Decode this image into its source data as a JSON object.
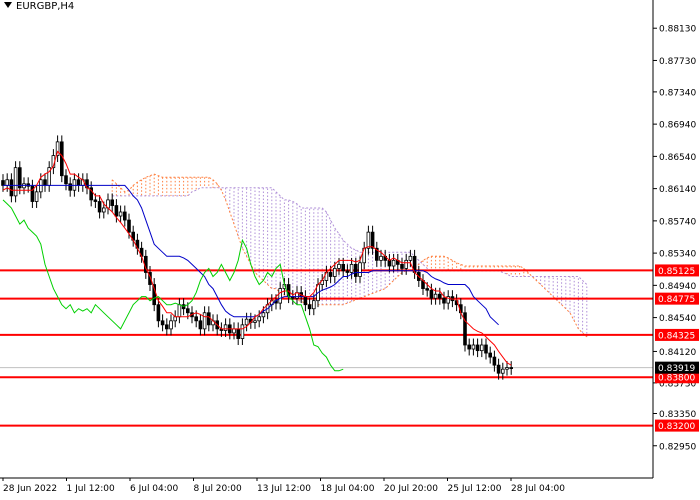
{
  "symbol": "EURGBP,H4",
  "colors": {
    "background": "#ffffff",
    "axis": "#000000",
    "candle": "#000000",
    "tenkan": "#ff0000",
    "kijun": "#0000c8",
    "chikou": "#00d000",
    "cloud_a": "#ff8040",
    "cloud_b": "#b090d8",
    "level_line": "#ff0000",
    "level_label_bg": "#ff0000",
    "level_label_text": "#ffffff",
    "current_price_bg": "#000000",
    "current_price_text": "#ffffff"
  },
  "chart_data": {
    "type": "candlestick",
    "title": "EURGBP,H4",
    "ylim": [
      0.8255,
      0.8848
    ],
    "y_ticks": [
      "0.88130",
      "0.87730",
      "0.87340",
      "0.86940",
      "0.86540",
      "0.86140",
      "0.85740",
      "0.85340",
      "0.84940",
      "0.84540",
      "0.84120",
      "0.83730",
      "0.83350",
      "0.82950"
    ],
    "x_tick_labels": [
      "28 Jun 2022",
      "1 Jul 12:00",
      "6 Jul 04:00",
      "8 Jul 20:00",
      "13 Jul 12:00",
      "18 Jul 04:00",
      "20 Jul 20:00",
      "25 Jul 12:00",
      "28 Jul 04:00"
    ],
    "levels": [
      {
        "label": "0.85125",
        "value": 0.85125
      },
      {
        "label": "0.84775",
        "value": 0.84775
      },
      {
        "label": "0.84325",
        "value": 0.84325
      },
      {
        "label": "0.83800",
        "value": 0.838
      },
      {
        "label": "0.83200",
        "value": 0.832
      }
    ],
    "current_price": {
      "label": "0.83919",
      "value": 0.83919
    },
    "close": [
      0.8618,
      0.8625,
      0.8605,
      0.864,
      0.8615,
      0.862,
      0.8617,
      0.8598,
      0.861,
      0.8625,
      0.8618,
      0.864,
      0.8655,
      0.8672,
      0.863,
      0.862,
      0.8612,
      0.8625,
      0.8618,
      0.8625,
      0.8615,
      0.86,
      0.8598,
      0.8585,
      0.859,
      0.86,
      0.8593,
      0.858,
      0.8585,
      0.8575,
      0.856,
      0.855,
      0.854,
      0.853,
      0.851,
      0.8495,
      0.847,
      0.845,
      0.8445,
      0.844,
      0.845,
      0.8455,
      0.847,
      0.8465,
      0.846,
      0.8455,
      0.845,
      0.844,
      0.846,
      0.8445,
      0.845,
      0.844,
      0.8438,
      0.8445,
      0.8435,
      0.844,
      0.8428,
      0.8445,
      0.8452,
      0.8448,
      0.845,
      0.8455,
      0.846,
      0.847,
      0.8475,
      0.8472,
      0.849,
      0.8495,
      0.848,
      0.8478,
      0.8485,
      0.848,
      0.847,
      0.8465,
      0.8475,
      0.8495,
      0.85,
      0.851,
      0.8505,
      0.8515,
      0.852,
      0.8512,
      0.851,
      0.852,
      0.8505,
      0.8522,
      0.854,
      0.856,
      0.854,
      0.8525,
      0.853,
      0.8525,
      0.8518,
      0.8525,
      0.852,
      0.8515,
      0.8525,
      0.853,
      0.851,
      0.85,
      0.849,
      0.8488,
      0.8478,
      0.8483,
      0.8478,
      0.8472,
      0.848,
      0.8475,
      0.847,
      0.846,
      0.842,
      0.8415,
      0.842,
      0.8413,
      0.842,
      0.841,
      0.8405,
      0.8395,
      0.8385,
      0.839,
      0.8392,
      0.8391
    ],
    "tenkan": [
      0.8612,
      0.8615,
      0.8612,
      0.8612,
      0.8612,
      0.8612,
      0.8612,
      0.8612,
      0.8618,
      0.8628,
      0.8632,
      0.8635,
      0.8642,
      0.866,
      0.8655,
      0.8645,
      0.8632,
      0.8632,
      0.8628,
      0.8625,
      0.8615,
      0.8612,
      0.8605,
      0.8605,
      0.8595,
      0.859,
      0.8585,
      0.8578,
      0.8572,
      0.8565,
      0.8558,
      0.855,
      0.854,
      0.853,
      0.8515,
      0.8505,
      0.849,
      0.8475,
      0.8468,
      0.846,
      0.846,
      0.8455,
      0.8455,
      0.8455,
      0.8455,
      0.8458,
      0.846,
      0.8458,
      0.8455,
      0.8455,
      0.845,
      0.8445,
      0.844,
      0.844,
      0.844,
      0.844,
      0.844,
      0.844,
      0.8443,
      0.8448,
      0.8455,
      0.8458,
      0.8465,
      0.847,
      0.8475,
      0.848,
      0.8485,
      0.8487,
      0.8487,
      0.8482,
      0.8485,
      0.8482,
      0.848,
      0.848,
      0.8485,
      0.8495,
      0.85,
      0.851,
      0.8515,
      0.852,
      0.8525,
      0.8525,
      0.8525,
      0.8525,
      0.8523,
      0.8525,
      0.854,
      0.8542,
      0.8542,
      0.8538,
      0.8535,
      0.853,
      0.8525,
      0.8528,
      0.8525,
      0.8522,
      0.8522,
      0.8522,
      0.851,
      0.8505,
      0.85,
      0.8495,
      0.849,
      0.8487,
      0.8487,
      0.848,
      0.8478,
      0.8477,
      0.8477,
      0.846,
      0.845,
      0.8445,
      0.844,
      0.8437,
      0.8435,
      0.843,
      0.8425,
      0.842,
      0.8412,
      0.8405,
      0.8398,
      0.8395
    ],
    "kijun": [
      0.8618,
      0.8618,
      0.8618,
      0.8618,
      0.8618,
      0.8618,
      0.8618,
      0.8618,
      0.8618,
      0.8618,
      0.8618,
      0.8618,
      0.8618,
      0.8618,
      0.8618,
      0.8618,
      0.8618,
      0.8618,
      0.8618,
      0.8618,
      0.8618,
      0.8618,
      0.8618,
      0.8618,
      0.8618,
      0.8618,
      0.8618,
      0.8618,
      0.8618,
      0.8618,
      0.8612,
      0.8605,
      0.86,
      0.859,
      0.8575,
      0.856,
      0.8545,
      0.854,
      0.8535,
      0.853,
      0.853,
      0.853,
      0.853,
      0.8528,
      0.8525,
      0.852,
      0.8515,
      0.851,
      0.8505,
      0.8495,
      0.849,
      0.848,
      0.847,
      0.8462,
      0.8458,
      0.8455,
      0.8455,
      0.8455,
      0.8455,
      0.8455,
      0.8455,
      0.8458,
      0.8462,
      0.8465,
      0.847,
      0.8475,
      0.8478,
      0.848,
      0.848,
      0.848,
      0.848,
      0.848,
      0.848,
      0.848,
      0.848,
      0.8485,
      0.8488,
      0.849,
      0.8492,
      0.8495,
      0.85,
      0.8505,
      0.8505,
      0.8508,
      0.851,
      0.851,
      0.851,
      0.851,
      0.8512,
      0.8512,
      0.8512,
      0.8512,
      0.8512,
      0.8512,
      0.8512,
      0.8512,
      0.8512,
      0.8512,
      0.8512,
      0.8512,
      0.8512,
      0.851,
      0.8505,
      0.8502,
      0.85,
      0.8497,
      0.8495,
      0.8495,
      0.8495,
      0.8495,
      0.8495,
      0.849,
      0.848,
      0.8475,
      0.847,
      0.8465,
      0.8455,
      0.845,
      0.8445
    ],
    "chikou": [
      0.86,
      0.8595,
      0.859,
      0.858,
      0.857,
      0.8575,
      0.8565,
      0.856,
      0.8555,
      0.8545,
      0.852,
      0.8505,
      0.849,
      0.848,
      0.847,
      0.8465,
      0.847,
      0.846,
      0.8465,
      0.8462,
      0.8465,
      0.846,
      0.847,
      0.8465,
      0.846,
      0.8455,
      0.845,
      0.8445,
      0.844,
      0.845,
      0.846,
      0.847,
      0.8475,
      0.848,
      0.848,
      0.8475,
      0.8478,
      0.848,
      0.8475,
      0.847,
      0.847,
      0.8472,
      0.847,
      0.8468,
      0.847,
      0.8475,
      0.8485,
      0.85,
      0.851,
      0.8515,
      0.8505,
      0.851,
      0.852,
      0.851,
      0.85,
      0.851,
      0.8525,
      0.855,
      0.854,
      0.852,
      0.8505,
      0.8495,
      0.85,
      0.851,
      0.8505,
      0.8515,
      0.852,
      0.8495,
      0.848,
      0.8475,
      0.847,
      0.847,
      0.8455,
      0.844,
      0.842,
      0.8418,
      0.841,
      0.8405,
      0.8395,
      0.8388,
      0.8388,
      0.839
    ],
    "span_a": [
      0.8625,
      0.862,
      0.8615,
      0.861,
      0.8612,
      0.8618,
      0.8622,
      0.8625,
      0.8628,
      0.863,
      0.8632,
      0.863,
      0.8628,
      0.8628,
      0.8628,
      0.8628,
      0.8628,
      0.8628,
      0.8628,
      0.8628,
      0.8628,
      0.8628,
      0.8628,
      0.8628,
      0.8625,
      0.862,
      0.8612,
      0.86,
      0.8585,
      0.857,
      0.8555,
      0.854,
      0.853,
      0.852,
      0.851,
      0.8505,
      0.85,
      0.8495,
      0.849,
      0.849,
      0.8485,
      0.8482,
      0.848,
      0.8478,
      0.8476,
      0.8474,
      0.8472,
      0.847,
      0.847,
      0.847,
      0.847,
      0.847,
      0.847,
      0.847,
      0.847,
      0.847,
      0.8472,
      0.8474,
      0.8476,
      0.8478,
      0.848,
      0.8482,
      0.8484,
      0.8486,
      0.8488,
      0.849,
      0.8495,
      0.85,
      0.8505,
      0.851,
      0.8512,
      0.8512,
      0.8515,
      0.852,
      0.8525,
      0.8528,
      0.853,
      0.853,
      0.853,
      0.853,
      0.8528,
      0.8525,
      0.8522,
      0.852,
      0.8518,
      0.8518,
      0.8518,
      0.8518,
      0.8518,
      0.8518,
      0.8518,
      0.8518,
      0.8518,
      0.8518,
      0.8518,
      0.8518,
      0.8518,
      0.8518,
      0.8515,
      0.851,
      0.8505,
      0.85,
      0.8495,
      0.849,
      0.8485,
      0.848,
      0.8475,
      0.847,
      0.8465,
      0.846,
      0.845,
      0.844,
      0.8435,
      0.843
    ],
    "span_b": [
      0.8605,
      0.8605,
      0.8605,
      0.8605,
      0.8605,
      0.8605,
      0.8605,
      0.8605,
      0.8605,
      0.8605,
      0.8605,
      0.8605,
      0.8605,
      0.8605,
      0.8605,
      0.8605,
      0.8605,
      0.8605,
      0.8605,
      0.861,
      0.8612,
      0.8615,
      0.8615,
      0.8615,
      0.8615,
      0.8615,
      0.8615,
      0.8615,
      0.8615,
      0.8615,
      0.8615,
      0.8615,
      0.8615,
      0.8615,
      0.8615,
      0.8615,
      0.8615,
      0.8615,
      0.8615,
      0.861,
      0.8605,
      0.86,
      0.86,
      0.8598,
      0.8595,
      0.859,
      0.859,
      0.859,
      0.859,
      0.859,
      0.859,
      0.8585,
      0.8575,
      0.8565,
      0.8558,
      0.855,
      0.8545,
      0.854,
      0.8538,
      0.8535,
      0.8535,
      0.8535,
      0.8535,
      0.8535,
      0.8535,
      0.8535,
      0.8535,
      0.8535,
      0.8535,
      0.8535,
      0.8535,
      0.8535,
      0.853,
      0.8525,
      0.852,
      0.8515,
      0.8512,
      0.8512,
      0.8512,
      0.8512,
      0.8512,
      0.8512,
      0.8512,
      0.8512,
      0.8512,
      0.8512,
      0.8512,
      0.8512,
      0.8512,
      0.8512,
      0.8512,
      0.8512,
      0.8512,
      0.851,
      0.8508,
      0.8505,
      0.8505,
      0.8505,
      0.8505,
      0.8505,
      0.8505,
      0.8505,
      0.8505,
      0.8505,
      0.8505,
      0.8505,
      0.8505,
      0.8505,
      0.8505,
      0.8505,
      0.8505,
      0.8505,
      0.85,
      0.8495
    ]
  }
}
